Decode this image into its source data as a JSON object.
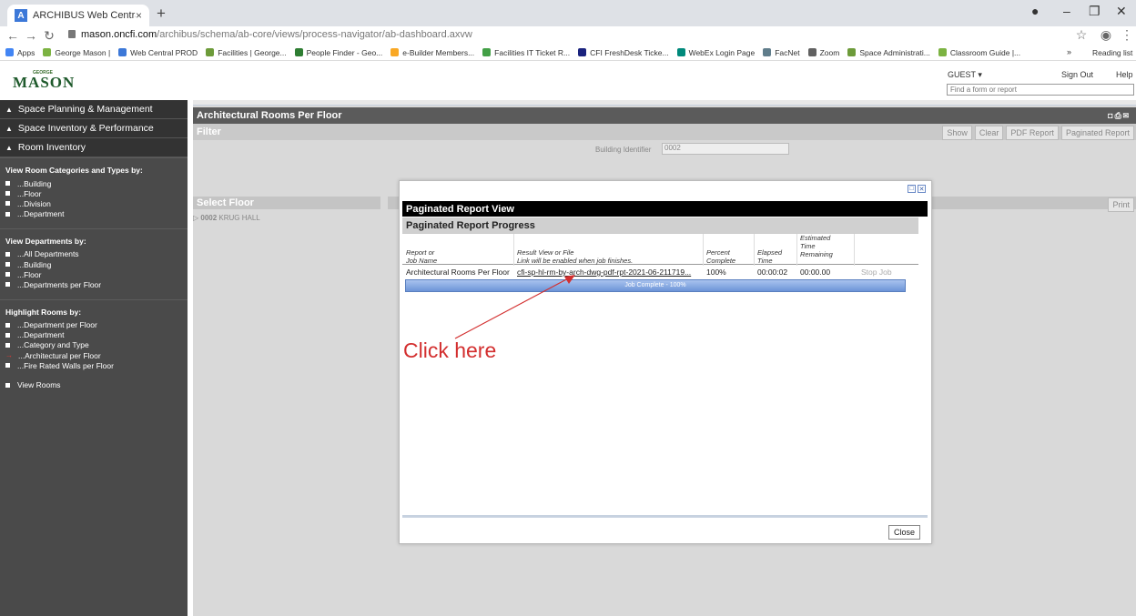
{
  "browser": {
    "tab_title": "ARCHIBUS Web Central",
    "tab_close": "×",
    "new_tab": "+",
    "url_host": "mason.oncfi.com",
    "url_path": "/archibus/schema/ab-core/views/process-navigator/ab-dashboard.axvw",
    "bookmarks": [
      {
        "label": "Apps",
        "color": "#4285f4"
      },
      {
        "label": "George Mason |",
        "color": "#7cb342"
      },
      {
        "label": "Web Central PROD",
        "color": "#3c78d8"
      },
      {
        "label": "Facilities | George...",
        "color": "#6d9b3a"
      },
      {
        "label": "People Finder - Geo...",
        "color": "#2e7d32"
      },
      {
        "label": "e-Builder Members...",
        "color": "#f9a825"
      },
      {
        "label": "Facilities IT Ticket R...",
        "color": "#43a047"
      },
      {
        "label": "CFI FreshDesk Ticke...",
        "color": "#1a237e"
      },
      {
        "label": "WebEx Login Page",
        "color": "#00897b"
      },
      {
        "label": "FacNet",
        "color": "#607d8b"
      },
      {
        "label": "Zoom",
        "color": "#616161"
      },
      {
        "label": "Space Administrati...",
        "color": "#6d9b3a"
      },
      {
        "label": "Classroom Guide |...",
        "color": "#7cb342"
      }
    ],
    "bookmarks_more": "»",
    "reading_list": "Reading list"
  },
  "header": {
    "logo_small": "GEORGE",
    "logo_main": "MASON",
    "guest": "GUEST ▾",
    "sign_out": "Sign Out",
    "help": "Help",
    "find_placeholder": "Find a form or report"
  },
  "sidebar": {
    "sections": [
      "Space Planning & Management",
      "Space Inventory & Performance",
      "Room Inventory"
    ],
    "group1_title": "View Room Categories and Types by:",
    "group1_items": [
      "...Building",
      "...Floor",
      "...Division",
      "...Department"
    ],
    "group2_title": "View Departments by:",
    "group2_items": [
      "...All Departments",
      "...Building",
      "...Floor",
      "...Departments per Floor"
    ],
    "group3_title": "Highlight Rooms by:",
    "group3_items": [
      "...Department per Floor",
      "...Department",
      "...Category and Type",
      "...Architectural per Floor",
      "...Fire Rated Walls per Floor"
    ],
    "view_rooms": "View Rooms"
  },
  "main": {
    "title": "Architectural Rooms Per Floor",
    "filter_title": "Filter",
    "buttons": [
      "Show",
      "Clear",
      "PDF Report",
      "Paginated Report"
    ],
    "building_label": "Building Identifier",
    "building_value": "0002",
    "select_floor": "Select Floor",
    "floor_code": "0002",
    "floor_name": "KRUG HALL",
    "print": "Print"
  },
  "modal": {
    "title": "Paginated Report View",
    "subtitle": "Paginated Report Progress",
    "col_report": "Report or",
    "col_job": "Job Name",
    "col_result": "Result View or File",
    "col_result_note": "Link will be enabled when job finishes.",
    "col_percent_1": "Percent",
    "col_percent_2": "Complete",
    "col_elapsed_1": "Elapsed",
    "col_elapsed_2": "Time",
    "col_est_1": "Estimated",
    "col_est_2": "Time",
    "col_est_3": "Remaining",
    "row_name": "Architectural Rooms Per Floor",
    "row_link": "cfi-sp-hl-rm-by-arch-dwg-pdf-rpt-2021-06-211719...",
    "row_percent": "100%",
    "row_elapsed": "00:00:02",
    "row_remaining": "00:00.00",
    "row_stop": "Stop Job",
    "progress_label": "Job Complete - 100%",
    "progress_value": 100,
    "close": "Close"
  },
  "annotation": {
    "text": "Click here",
    "color": "#d32f2f"
  }
}
